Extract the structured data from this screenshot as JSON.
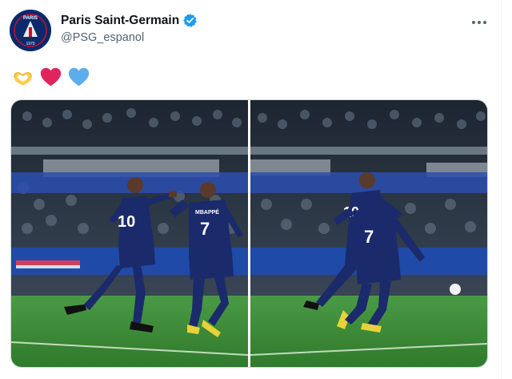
{
  "tweet": {
    "display_name": "Paris Saint-Germain",
    "handle": "@PSG_espanol",
    "verified": true,
    "avatar_label": "PARIS",
    "more_icon": "more-horizontal-icon",
    "emojis": [
      "heart-hands-emoji",
      "red-heart-emoji",
      "blue-heart-emoji"
    ]
  },
  "media": {
    "photos": [
      {
        "players": [
          {
            "number": "10"
          },
          {
            "number": "7",
            "name": "MBAPPÉ"
          }
        ]
      },
      {
        "players": [
          {
            "number": "10"
          },
          {
            "number": "7"
          }
        ]
      }
    ]
  },
  "colors": {
    "psg_navy": "#1b2a6b",
    "pitch_green": "#3d8a3a",
    "verified_blue": "#1d9bf0",
    "heart_red": "#e0245e",
    "heart_blue": "#5dadec",
    "heart_hands_yellow": "#ffcc4d"
  }
}
